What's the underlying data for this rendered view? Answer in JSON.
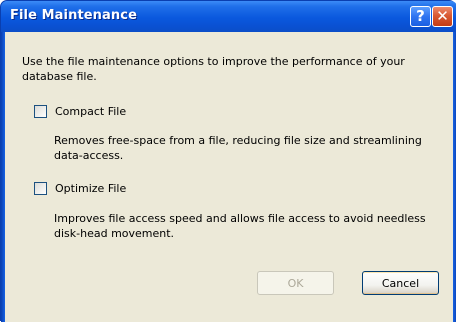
{
  "window": {
    "title": "File Maintenance"
  },
  "titlebar_buttons": {
    "help_glyph": "?",
    "close_glyph": "✕"
  },
  "dialog": {
    "intro": "Use the file maintenance options to improve the performance of your database file.",
    "options": [
      {
        "label": "Compact File",
        "checked": false,
        "description": "Removes free-space from a file, reducing file size and streamlining data-access."
      },
      {
        "label": "Optimize File",
        "checked": false,
        "description": "Improves file access speed and allows file access to avoid needless disk-head movement."
      }
    ]
  },
  "buttons": {
    "ok": "OK",
    "cancel": "Cancel"
  },
  "colors": {
    "titlebar": "#0a58de",
    "client": "#ece9d8",
    "close_button": "#d95a34"
  },
  "icons": [
    "help-icon",
    "close-icon"
  ]
}
